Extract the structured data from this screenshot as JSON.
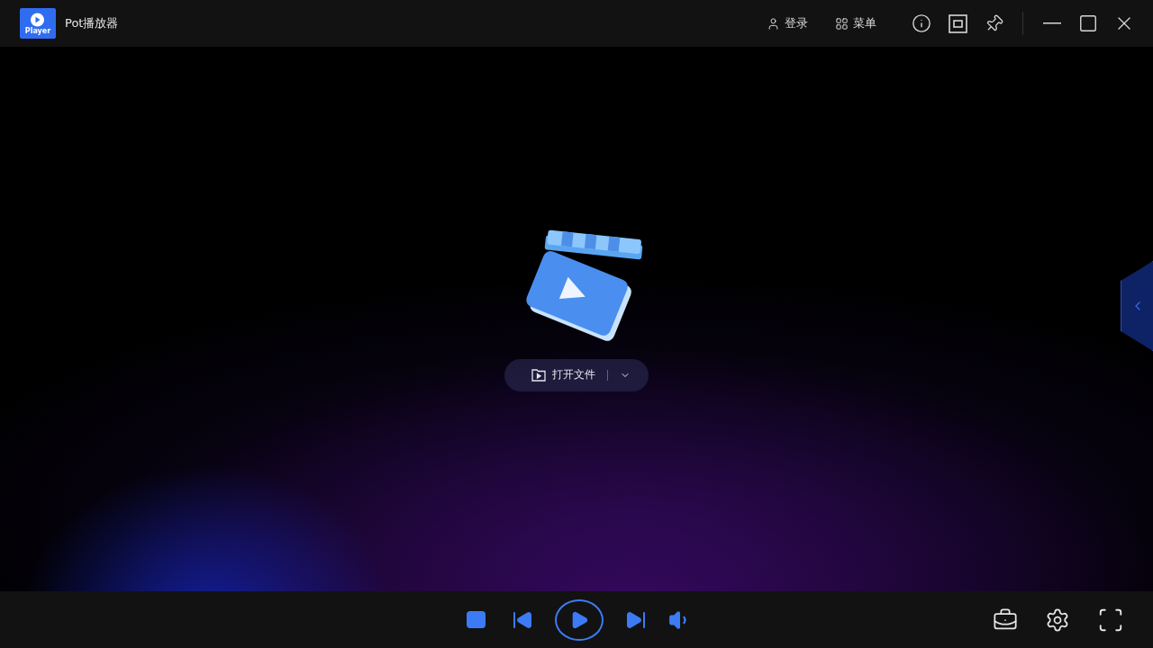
{
  "app": {
    "logo_text": "Player",
    "title": "Pot播放器"
  },
  "header_actions": [
    {
      "label": "登录",
      "kind": "user"
    },
    {
      "label": "菜单",
      "kind": "grid"
    }
  ],
  "open_button": {
    "label": "打开文件"
  }
}
